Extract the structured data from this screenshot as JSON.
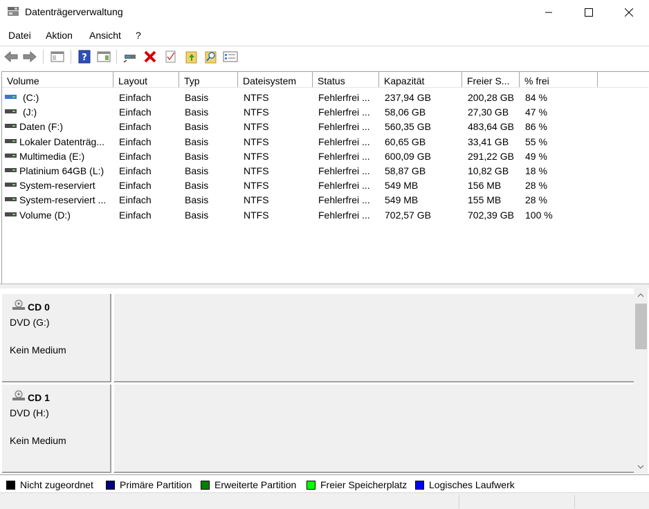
{
  "window": {
    "title": "Datenträgerverwaltung",
    "icon": "disk-management-icon"
  },
  "menu": [
    "Datei",
    "Aktion",
    "Ansicht",
    "?"
  ],
  "toolbar": {
    "icons": [
      "back-arrow-icon",
      "forward-arrow-icon",
      "console-tree-icon",
      "help-icon",
      "action-pane-icon",
      "connect-disk-icon",
      "delete-icon",
      "check-icon",
      "open-folder-icon",
      "search-icon",
      "properties-icon"
    ]
  },
  "volume_list": {
    "columns": [
      "Volume",
      "Layout",
      "Typ",
      "Dateisystem",
      "Status",
      "Kapazität",
      "Freier S...",
      "% frei"
    ],
    "rows": [
      {
        "volume": "(C:)",
        "layout": "Einfach",
        "typ": "Basis",
        "fs": "NTFS",
        "status": "Fehlerfrei ...",
        "capacity": "237,94 GB",
        "free": "200,28 GB",
        "pct": "84 %",
        "system": true
      },
      {
        "volume": "(J:)",
        "layout": "Einfach",
        "typ": "Basis",
        "fs": "NTFS",
        "status": "Fehlerfrei ...",
        "capacity": "58,06 GB",
        "free": "27,30 GB",
        "pct": "47 %",
        "system": false
      },
      {
        "volume": "Daten (F:)",
        "layout": "Einfach",
        "typ": "Basis",
        "fs": "NTFS",
        "status": "Fehlerfrei ...",
        "capacity": "560,35 GB",
        "free": "483,64 GB",
        "pct": "86 %",
        "system": false
      },
      {
        "volume": "Lokaler Datenträg...",
        "layout": "Einfach",
        "typ": "Basis",
        "fs": "NTFS",
        "status": "Fehlerfrei ...",
        "capacity": "60,65 GB",
        "free": "33,41 GB",
        "pct": "55 %",
        "system": false
      },
      {
        "volume": "Multimedia  (E:)",
        "layout": "Einfach",
        "typ": "Basis",
        "fs": "NTFS",
        "status": "Fehlerfrei ...",
        "capacity": "600,09 GB",
        "free": "291,22 GB",
        "pct": "49 %",
        "system": false
      },
      {
        "volume": "Platinium 64GB (L:)",
        "layout": "Einfach",
        "typ": "Basis",
        "fs": "NTFS",
        "status": "Fehlerfrei ...",
        "capacity": "58,87 GB",
        "free": "10,82 GB",
        "pct": "18 %",
        "system": false
      },
      {
        "volume": "System-reserviert",
        "layout": "Einfach",
        "typ": "Basis",
        "fs": "NTFS",
        "status": "Fehlerfrei ...",
        "capacity": "549 MB",
        "free": "156 MB",
        "pct": "28 %",
        "system": false
      },
      {
        "volume": "System-reserviert ...",
        "layout": "Einfach",
        "typ": "Basis",
        "fs": "NTFS",
        "status": "Fehlerfrei ...",
        "capacity": "549 MB",
        "free": "155 MB",
        "pct": "28 %",
        "system": false
      },
      {
        "volume": "Volume (D:)",
        "layout": "Einfach",
        "typ": "Basis",
        "fs": "NTFS",
        "status": "Fehlerfrei ...",
        "capacity": "702,57 GB",
        "free": "702,39 GB",
        "pct": "100 %",
        "system": false
      }
    ]
  },
  "disks": [
    {
      "name": "CD 0",
      "type": "DVD (G:)",
      "media": "Kein Medium"
    },
    {
      "name": "CD 1",
      "type": "DVD (H:)",
      "media": "Kein Medium"
    }
  ],
  "legend": [
    {
      "label": "Nicht zugeordnet",
      "color": "#000000"
    },
    {
      "label": "Primäre Partition",
      "color": "#000080"
    },
    {
      "label": "Erweiterte Partition",
      "color": "#008000"
    },
    {
      "label": "Freier Speicherplatz",
      "color": "#00ff00"
    },
    {
      "label": "Logisches Laufwerk",
      "color": "#0000ff"
    }
  ],
  "colors": {
    "system_drive": "#3c78c8",
    "drive": "#4a4a4a",
    "delete_red": "#d40000"
  }
}
